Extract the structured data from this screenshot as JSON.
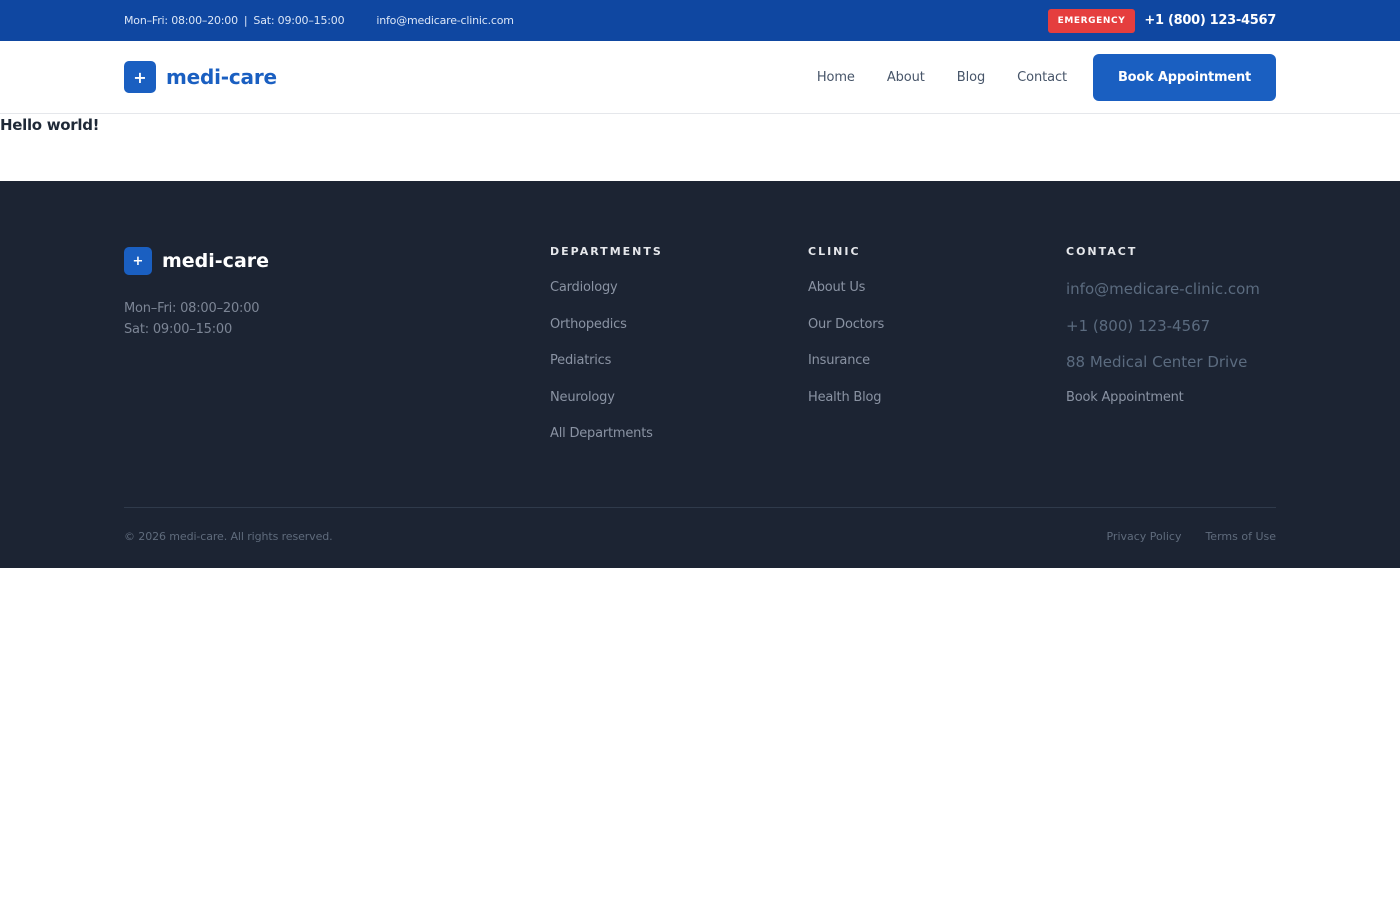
{
  "topbar": {
    "hours": "Mon–Fri: 08:00–20:00",
    "separator": "|",
    "saturday": "Sat: 09:00–15:00",
    "email": "info@medicare-clinic.com",
    "emergency_label": "EMERGENCY",
    "phone": "+1 (800) 123-4567"
  },
  "header": {
    "logo_icon": "+",
    "logo_text": "medi-care",
    "nav": [
      "Home",
      "About",
      "Blog",
      "Contact"
    ],
    "cta": "Book Appointment"
  },
  "main": {
    "text": "Hello world!"
  },
  "footer": {
    "logo_icon": "+",
    "logo_text": "medi-care",
    "hours_weekday": "Mon–Fri: 08:00–20:00",
    "hours_saturday": "Sat: 09:00–15:00",
    "departments": {
      "heading": "DEPARTMENTS",
      "items": [
        "Cardiology",
        "Orthopedics",
        "Pediatrics",
        "Neurology",
        "All Departments"
      ]
    },
    "clinic": {
      "heading": "CLINIC",
      "items": [
        "About Us",
        "Our Doctors",
        "Insurance",
        "Health Blog"
      ]
    },
    "contact": {
      "heading": "CONTACT",
      "email": "info@medicare-clinic.com",
      "phone": "+1 (800) 123-4567",
      "address": "88 Medical Center Drive",
      "book": "Book Appointment"
    },
    "copyright": "© 2026 medi-care. All rights reserved.",
    "privacy": "Privacy Policy",
    "terms": "Terms of Use"
  },
  "colors": {
    "topbar": "#0f47a1",
    "brand": "#1a5fc1",
    "emergency": "#e53e3e",
    "footer": "#1c2433"
  }
}
